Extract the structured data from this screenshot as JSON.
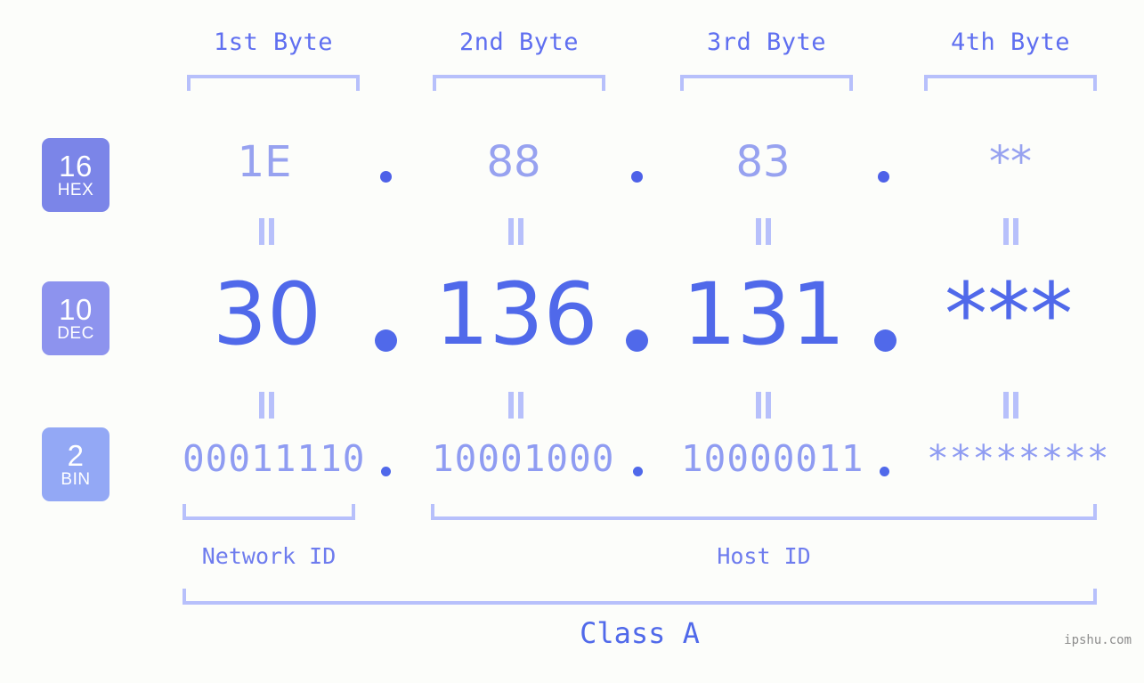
{
  "meta": {
    "background_color": "#fcfdfa",
    "accent_dark": "#5069ea",
    "accent_mid": "#7b85e8",
    "accent_light": "#b7c0fb"
  },
  "byte_headers": [
    {
      "label": "1st Byte"
    },
    {
      "label": "2nd Byte"
    },
    {
      "label": "3rd Byte"
    },
    {
      "label": "4th Byte"
    }
  ],
  "bases": [
    {
      "number": "16",
      "name": "HEX",
      "color": "#7b85e8"
    },
    {
      "number": "10",
      "name": "DEC",
      "color": "#8d93ee"
    },
    {
      "number": "2",
      "name": "BIN",
      "color": "#93a8f5"
    }
  ],
  "rows": {
    "hex": {
      "values": [
        "1E",
        "88",
        "83",
        "**"
      ],
      "separators": [
        ".",
        ".",
        "."
      ]
    },
    "dec": {
      "values": [
        "30",
        "136",
        "131",
        "***"
      ],
      "separators": [
        ".",
        ".",
        "."
      ]
    },
    "bin": {
      "values": [
        "00011110",
        "10001000",
        "10000011",
        "********"
      ],
      "separators": [
        ".",
        ".",
        "."
      ]
    }
  },
  "equals_symbol": "=",
  "sections": [
    {
      "label": "Network ID"
    },
    {
      "label": "Host ID"
    }
  ],
  "class": {
    "label": "Class A"
  },
  "watermark": {
    "text": "ipshu.com"
  }
}
